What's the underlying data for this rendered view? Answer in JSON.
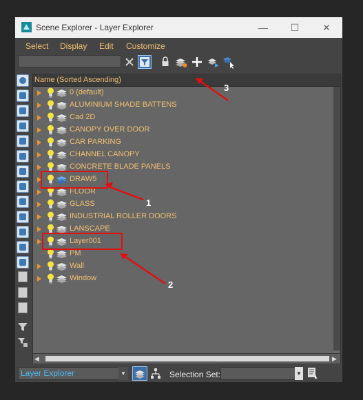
{
  "window": {
    "title": "Scene Explorer - Layer Explorer",
    "controls": {
      "minimize": "—",
      "maximize": "☐",
      "close": "✕"
    }
  },
  "menu": [
    "Select",
    "Display",
    "Edit",
    "Customize"
  ],
  "toolbar": {
    "search_value": "",
    "icons": [
      "clear-search-icon",
      "filter-toggle-icon",
      "lock-icon",
      "layers-highlight-icon",
      "add-layer-icon",
      "move-to-layer-icon",
      "select-layer-icon"
    ]
  },
  "list": {
    "column_header": "Name (Sorted Ascending)",
    "rows": [
      {
        "name": "0 (default)",
        "expander": true,
        "bulb": true
      },
      {
        "name": "ALUMINIUM SHADE BATTENS",
        "expander": true,
        "bulb": true
      },
      {
        "name": "Cad 2D",
        "expander": true,
        "bulb": true
      },
      {
        "name": "CANOPY OVER DOOR",
        "expander": true,
        "bulb": true
      },
      {
        "name": "CAR PARKING",
        "expander": true,
        "bulb": true
      },
      {
        "name": "CHANNEL CANOPY",
        "expander": true,
        "bulb": true
      },
      {
        "name": "CONCRETE BLADE PANELS",
        "expander": true,
        "bulb": true
      },
      {
        "name": "DRAW5",
        "expander": true,
        "bulb": true,
        "active": true
      },
      {
        "name": "FLOOR",
        "expander": true,
        "bulb": true
      },
      {
        "name": "GLASS",
        "expander": true,
        "bulb": true
      },
      {
        "name": "INDUSTRIAL ROLLER DOORS",
        "expander": true,
        "bulb": true
      },
      {
        "name": "LANSCAPE",
        "expander": true,
        "bulb": true
      },
      {
        "name": "Layer001",
        "expander": true,
        "bulb": true
      },
      {
        "name": "PM",
        "expander": false,
        "bulb": true
      },
      {
        "name": "Wall",
        "expander": true,
        "bulb": true
      },
      {
        "name": "Window",
        "expander": true,
        "bulb": true
      }
    ]
  },
  "statusbar": {
    "explorer_value": "Layer Explorer",
    "selection_set_label": "Selection Set:",
    "selection_set_value": ""
  },
  "annotations": {
    "label_1": "1",
    "label_2": "2",
    "label_3": "3",
    "color": "#e01010"
  },
  "colors": {
    "accent_text": "#f0c070",
    "highlight_blue": "#4fb8f0",
    "annotation_red": "#e01010"
  }
}
